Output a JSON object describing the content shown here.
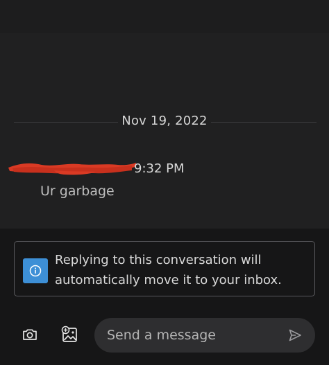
{
  "conversation": {
    "date_label": "Nov 19, 2022",
    "message": {
      "time": "9:32 PM",
      "text": "Ur garbage"
    }
  },
  "reply_notice": {
    "line1": "Replying to this conversation will",
    "line2": "automatically move it to your inbox.",
    "icon": "info-icon"
  },
  "composer": {
    "placeholder": "Send a message",
    "value": ""
  },
  "toolbar": {
    "camera_icon": "camera-icon",
    "gallery_icon": "add-photo-icon",
    "send_icon": "send-icon"
  },
  "colors": {
    "background": "#1e1e1f",
    "chat_background": "#202021",
    "bottom_background": "#161617",
    "accent_info": "#3d8fd6",
    "redaction": "#d93a24",
    "composer_background": "#2e2e30"
  }
}
